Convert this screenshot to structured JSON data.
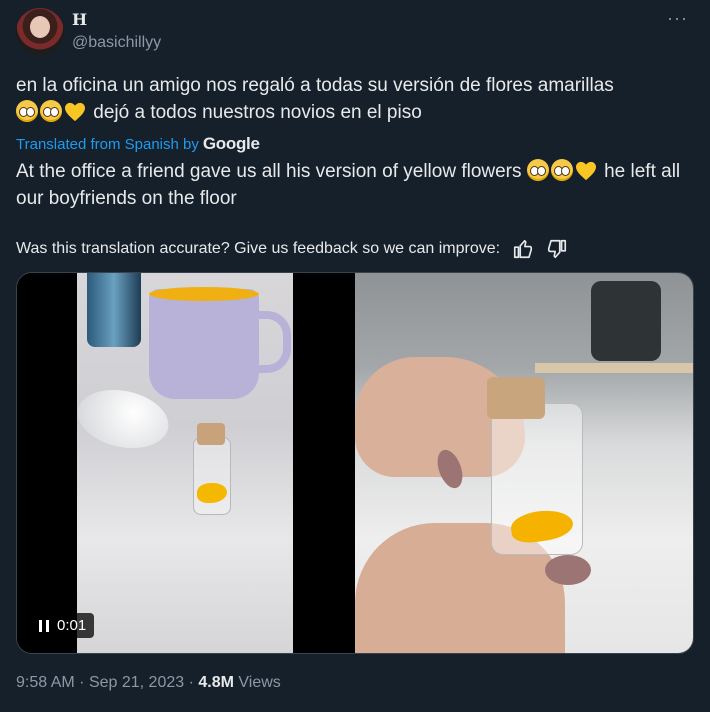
{
  "author": {
    "display_name": "H",
    "handle": "@basichillyy"
  },
  "tweet": {
    "original_text": "en la oficina un amigo nos regaló a todas su versión de flores amarillas",
    "original_text_2": "dejó a todos nuestros novios en el piso",
    "translation_label": "Translated from Spanish by",
    "translation_provider": "Google",
    "translated_text_1": "At the office a friend gave us all his version of yellow flowers",
    "translated_text_2": "he",
    "translated_text_3": "left all our boyfriends on the floor",
    "feedback_prompt": "Was this translation accurate? Give us feedback so we can improve:"
  },
  "media": {
    "video_time": "0:01"
  },
  "meta": {
    "time": "9:58 AM",
    "date": "Sep 21, 2023",
    "views_count": "4.8M",
    "views_label": "Views",
    "sep": "·"
  },
  "icons": {
    "more": "more-options-icon",
    "thumbs_up": "thumbs-up-icon",
    "thumbs_down": "thumbs-down-icon",
    "pleading": "pleading-face-emoji",
    "heart": "yellow-heart-emoji",
    "pause": "pause-icon"
  },
  "colors": {
    "background": "#15202b",
    "link": "#1d9bf0",
    "muted": "#8b98a5",
    "text": "#e7e9ea"
  }
}
